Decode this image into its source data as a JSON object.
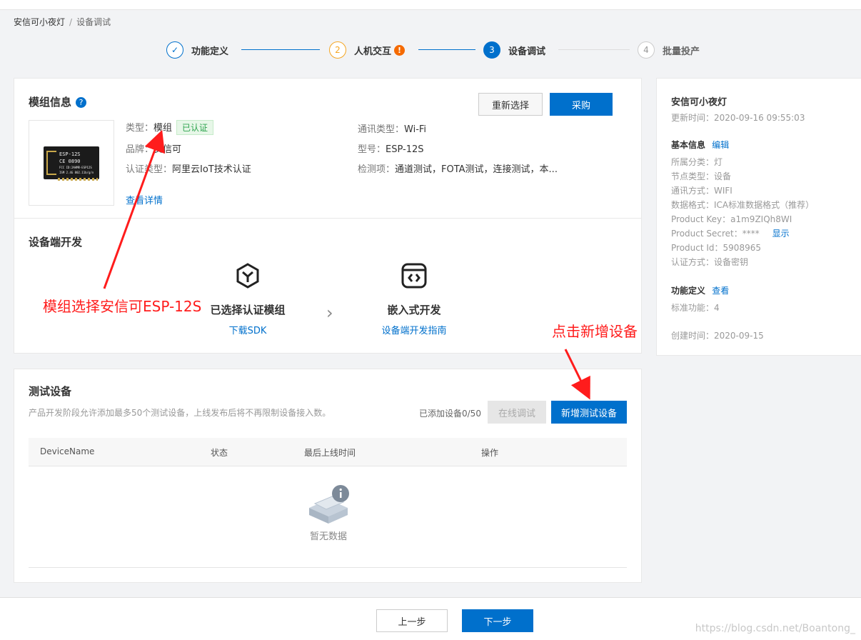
{
  "breadcrumb": {
    "root": "安信可小夜灯",
    "sep": "/",
    "current": "设备调试"
  },
  "steps": [
    {
      "label": "功能定义",
      "mark": "✓"
    },
    {
      "label": "人机交互",
      "mark": "2",
      "warn": "!"
    },
    {
      "label": "设备调试",
      "mark": "3"
    },
    {
      "label": "批量投产",
      "mark": "4"
    }
  ],
  "module": {
    "title": "模组信息",
    "help": "?",
    "reselect_label": "重新选择",
    "buy_label": "采购",
    "chip_text": [
      "ESP-12S",
      "CE 0890",
      "FCC ID:2AHMR-ESP12S",
      "ISM 2.4G  802.11b/g/n"
    ],
    "type_k": "类型：",
    "type_v": "模组",
    "certified_tag": "已认证",
    "brand_k": "品牌：",
    "brand_v": "安信可",
    "cert_k": "认证类型：",
    "cert_v": "阿里云IoT技术认证",
    "comm_k": "通讯类型：",
    "comm_v": "Wi-Fi",
    "model_k": "型号：",
    "model_v": "ESP-12S",
    "check_k": "检测项：",
    "check_v": "通道测试，FOTA测试，连接测试，本...",
    "details_link": "查看详情"
  },
  "dev": {
    "title": "设备端开发",
    "item1_label": "已选择认证模组",
    "item1_link": "下载SDK",
    "arrow": "›",
    "item2_label": "嵌入式开发",
    "item2_link": "设备端开发指南"
  },
  "test": {
    "title": "测试设备",
    "desc": "产品开发阶段允许添加最多50个测试设备，上线发布后将不再限制设备接入数。",
    "count": "已添加设备0/50",
    "online_debug_label": "在线调试",
    "add_label": "新增测试设备",
    "columns": [
      "DeviceName",
      "状态",
      "最后上线时间",
      "操作"
    ],
    "empty": "暂无数据"
  },
  "side": {
    "name": "安信可小夜灯",
    "update_time": "更新时间：2020-09-16 09:55:03",
    "basic_title": "基本信息",
    "basic_edit": "编辑",
    "rows": [
      "所属分类：灯",
      "节点类型：设备",
      "通讯方式：WIFI",
      "数据格式：ICA标准数据格式（推荐）",
      "Product Key：a1m9ZIQh8WI",
      "Product Secret：****",
      "Product Id：5908965",
      "认证方式：设备密钥"
    ],
    "secret_show": "显示",
    "func_title": "功能定义",
    "func_view": "查看",
    "func_count": "标准功能：4",
    "created": "创建时间：2020-09-15"
  },
  "annotations": {
    "module_note": "模组选择安信可ESP-12S",
    "add_note": "点击新增设备",
    "color": "#ff1c1c"
  },
  "footer": {
    "prev_label": "上一步",
    "next_label": "下一步"
  },
  "watermark": "https://blog.csdn.net/Boantong_"
}
